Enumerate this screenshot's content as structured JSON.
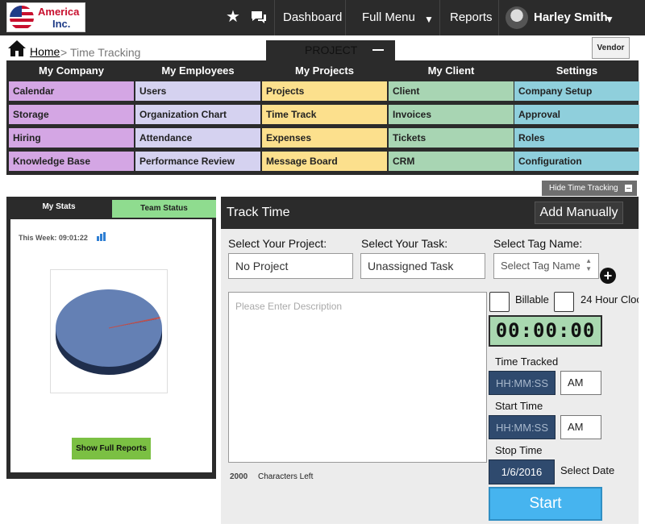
{
  "logo": {
    "line1": "America",
    "line2": "Inc."
  },
  "topnav": {
    "dashboard": "Dashboard",
    "full_menu": "Full Menu",
    "reports": "Reports",
    "user_name": "Harley Smith",
    "icons": [
      "star-icon",
      "chat-icon",
      "chevron-down-icon",
      "avatar",
      "chevron-down-icon"
    ]
  },
  "breadcrumb": {
    "home": "Home",
    "separator": ">",
    "current": "Time Tracking"
  },
  "project_tab": {
    "label": "PROJECT"
  },
  "vendor_button": "Vendor",
  "menu": {
    "columns": [
      {
        "title": "My Company",
        "color": "#d4a6e4",
        "items": [
          "Calendar",
          "Storage",
          "Hiring",
          "Knowledge Base"
        ]
      },
      {
        "title": "My Employees",
        "color": "#d5d2f0",
        "items": [
          "Users",
          "Organization Chart",
          "Attendance",
          "Performance Review"
        ]
      },
      {
        "title": "My Projects",
        "color": "#fce08d",
        "items": [
          "Projects",
          "Time Track",
          "Expenses",
          "Message Board"
        ]
      },
      {
        "title": "My Client",
        "color": "#a8d5b3",
        "items": [
          "Client",
          "Invoices",
          "Tickets",
          "CRM"
        ]
      },
      {
        "title": "Settings",
        "color": "#8fcfdc",
        "items": [
          "Company Setup",
          "Approval",
          "Roles",
          "Configuration"
        ]
      }
    ]
  },
  "hide_tracking": "Hide Time Tracking",
  "stats": {
    "tab_my_stats": "My Stats",
    "tab_team_status": "Team Status",
    "this_week": "This Week: 09:01:22",
    "show_reports": "Show Full Reports"
  },
  "chart_data": {
    "type": "pie",
    "values": [
      99.5,
      0.5
    ],
    "colors": [
      "#6480b4",
      "#c0504d"
    ]
  },
  "track": {
    "title": "Track Time",
    "add_manually": "Add Manually",
    "project_label": "Select Your Project:",
    "project_value": "No Project",
    "task_label": "Select Your Task:",
    "task_value": "Unassigned Task",
    "tag_label": "Select Tag Name:",
    "tag_value": "Select Tag Name",
    "description_placeholder": "Please Enter Description",
    "chars_left_count": "2000",
    "chars_left_label": "Characters Left",
    "billable": "Billable",
    "hour_clock": "24 Hour Cloc",
    "timer": "00:00:00",
    "time_tracked_label": "Time Tracked",
    "time_tracked_value": "HH:MM:SS",
    "time_tracked_ampm": "AM",
    "start_time_label": "Start Time",
    "start_time_value": "HH:MM:SS",
    "start_time_ampm": "AM",
    "stop_time_label": "Stop Time",
    "stop_date": "1/6/2016",
    "select_date": "Select Date",
    "start_button": "Start"
  }
}
